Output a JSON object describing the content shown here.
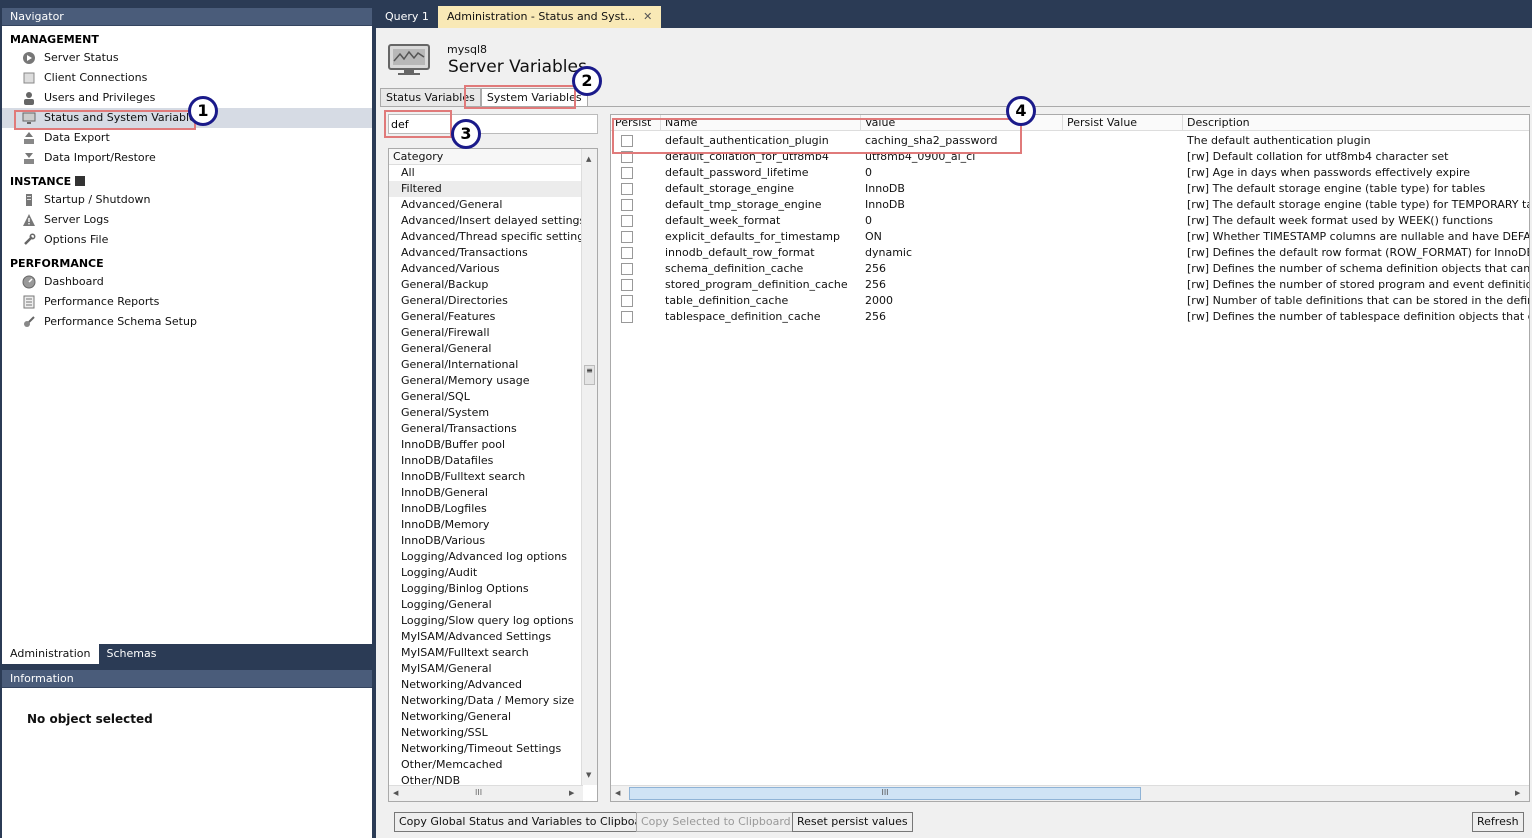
{
  "navigator": {
    "title": "Navigator",
    "sections": [
      {
        "title": "MANAGEMENT",
        "items": [
          {
            "label": "Server Status",
            "icon": "play-circle-icon"
          },
          {
            "label": "Client Connections",
            "icon": "connections-icon"
          },
          {
            "label": "Users and Privileges",
            "icon": "user-icon"
          },
          {
            "label": "Status and System Variables",
            "icon": "monitor-icon"
          },
          {
            "label": "Data Export",
            "icon": "export-icon"
          },
          {
            "label": "Data Import/Restore",
            "icon": "import-icon"
          }
        ]
      },
      {
        "title": "INSTANCE",
        "items": [
          {
            "label": "Startup / Shutdown",
            "icon": "server-icon"
          },
          {
            "label": "Server Logs",
            "icon": "warning-icon"
          },
          {
            "label": "Options File",
            "icon": "wrench-icon"
          }
        ]
      },
      {
        "title": "PERFORMANCE",
        "items": [
          {
            "label": "Dashboard",
            "icon": "dashboard-icon"
          },
          {
            "label": "Performance Reports",
            "icon": "reports-icon"
          },
          {
            "label": "Performance Schema Setup",
            "icon": "schema-setup-icon"
          }
        ]
      }
    ],
    "tabs": [
      "Administration",
      "Schemas"
    ]
  },
  "information": {
    "title": "Information",
    "empty_text": "No object selected"
  },
  "doc_tabs": [
    "Query 1",
    "Administration - Status and Syst..."
  ],
  "server": {
    "name": "mysql8",
    "title": "Server Variables"
  },
  "subtabs": [
    "Status Variables",
    "System Variables"
  ],
  "filter": {
    "value": "def"
  },
  "category": {
    "header": "Category",
    "items": [
      "All",
      "Filtered",
      "Advanced/General",
      "Advanced/Insert delayed settings",
      "Advanced/Thread specific settings",
      "Advanced/Transactions",
      "Advanced/Various",
      "General/Backup",
      "General/Directories",
      "General/Features",
      "General/Firewall",
      "General/General",
      "General/International",
      "General/Memory usage",
      "General/SQL",
      "General/System",
      "General/Transactions",
      "InnoDB/Buffer pool",
      "InnoDB/Datafiles",
      "InnoDB/Fulltext search",
      "InnoDB/General",
      "InnoDB/Logfiles",
      "InnoDB/Memory",
      "InnoDB/Various",
      "Logging/Advanced log options",
      "Logging/Audit",
      "Logging/Binlog Options",
      "Logging/General",
      "Logging/Slow query log options",
      "MyISAM/Advanced Settings",
      "MyISAM/Fulltext search",
      "MyISAM/General",
      "Networking/Advanced",
      "Networking/Data / Memory size",
      "Networking/General",
      "Networking/SSL",
      "Networking/Timeout Settings",
      "Other/Memcached",
      "Other/NDB"
    ],
    "selected": "Filtered"
  },
  "grid": {
    "headers": [
      "Persist",
      "Name",
      "Value",
      "Persist Value",
      "Description"
    ],
    "rows": [
      {
        "name": "default_authentication_plugin",
        "value": "caching_sha2_password",
        "desc": "The default authentication plugin"
      },
      {
        "name": "default_collation_for_utf8mb4",
        "value": "utf8mb4_0900_ai_ci",
        "desc": "[rw] Default collation for utf8mb4 character set"
      },
      {
        "name": "default_password_lifetime",
        "value": "0",
        "desc": "[rw] Age in days when passwords effectively expire"
      },
      {
        "name": "default_storage_engine",
        "value": "InnoDB",
        "desc": "[rw] The default storage engine (table type) for tables"
      },
      {
        "name": "default_tmp_storage_engine",
        "value": "InnoDB",
        "desc": "[rw] The default storage engine (table type) for TEMPORARY tables"
      },
      {
        "name": "default_week_format",
        "value": "0",
        "desc": "[rw] The default week format used by WEEK() functions"
      },
      {
        "name": "explicit_defaults_for_timestamp",
        "value": "ON",
        "desc": "[rw] Whether TIMESTAMP columns are nullable and have DEFAULT N"
      },
      {
        "name": "innodb_default_row_format",
        "value": "dynamic",
        "desc": "[rw] Defines the default row format (ROW_FORMAT) for InnoDB tab"
      },
      {
        "name": "schema_definition_cache",
        "value": "256",
        "desc": "[rw] Defines the number of schema definition objects that can be ke"
      },
      {
        "name": "stored_program_definition_cache",
        "value": "256",
        "desc": "[rw] Defines the number of stored program and event definition ob"
      },
      {
        "name": "table_definition_cache",
        "value": "2000",
        "desc": "[rw] Number of table definitions that can be stored in the definition"
      },
      {
        "name": "tablespace_definition_cache",
        "value": "256",
        "desc": "[rw] Defines the number of tablespace definition objects that can b"
      }
    ]
  },
  "buttons": {
    "copy_global": "Copy Global Status and Variables to Clipboard",
    "copy_selected": "Copy Selected to Clipboard",
    "reset_persist": "Reset persist values",
    "refresh": "Refresh"
  },
  "callouts": [
    "1",
    "2",
    "3",
    "4"
  ],
  "colors": {
    "callout_border": "#e07a7a",
    "badge_ring": "#1a1a8a",
    "header_bg": "#4a5c7a",
    "active_doc_tab": "#f9e9b6"
  }
}
